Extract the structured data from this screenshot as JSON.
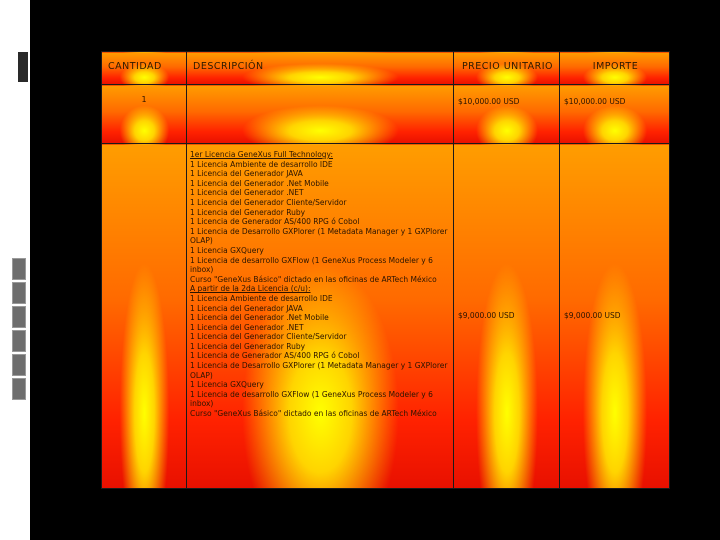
{
  "table": {
    "headers": [
      "CANTIDAD",
      "DESCRIPCIÓN",
      "PRECIO UNITARIO",
      "IMPORTE"
    ],
    "row1": {
      "cantidad": "1",
      "precio_unitario": "$10,000.00 USD",
      "importe": "$10,000.00 USD"
    },
    "row2": {
      "desc_title": "1er Licencia GeneXus Full Technology:",
      "desc_lines_a": [
        "1 Licencia Ambiente de desarrollo IDE",
        "1 Licencia del Generador JAVA",
        "1 Licencia del Generador .Net Mobile",
        "1 Licencia del Generador .NET",
        "1 Licencia del Generador Cliente/Servidor",
        "1 Licencia del Generador Ruby",
        "1 Licencia de Generador AS/400 RPG ó Cobol",
        "1 Licencia de Desarrollo GXPlorer (1 Metadata Manager y 1 GXPlorer OLAP)",
        "1 Licencia GXQuery",
        "1 Licencia de desarrollo GXFlow (1 GeneXus Process Modeler y 6 inbox)",
        "Curso \"GeneXus Básico\" dictado en las oficinas de ARTech México"
      ],
      "desc_second_title": "A partir de la 2da Licencia (c/u):",
      "desc_lines_b": [
        "1 Licencia Ambiente de desarrollo IDE",
        "1 Licencia del Generador JAVA",
        "1 Licencia del Generador .Net Mobile",
        "1 Licencia del Generador .NET",
        "1 Licencia del Generador Cliente/Servidor",
        "1 Licencia del Generador Ruby",
        "1 Licencia de Generador AS/400 RPG ó Cobol",
        "1 Licencia de Desarrollo GXPlorer (1 Metadata Manager y 1 GXPlorer OLAP)",
        "1 Licencia GXQuery",
        "1 Licencia de desarrollo GXFlow (1 GeneXus Process Modeler y 6 inbox)",
        "Curso \"GeneXus Básico\" dictado en las oficinas de ARTech México"
      ],
      "precio_unitario": "$9,000.00 USD",
      "importe": "$9,000.00 USD"
    }
  },
  "colors": {
    "page_background": "#000000",
    "cell_top": "#ff9d00",
    "cell_bottom": "#e81000",
    "glow": "#ffff00"
  }
}
